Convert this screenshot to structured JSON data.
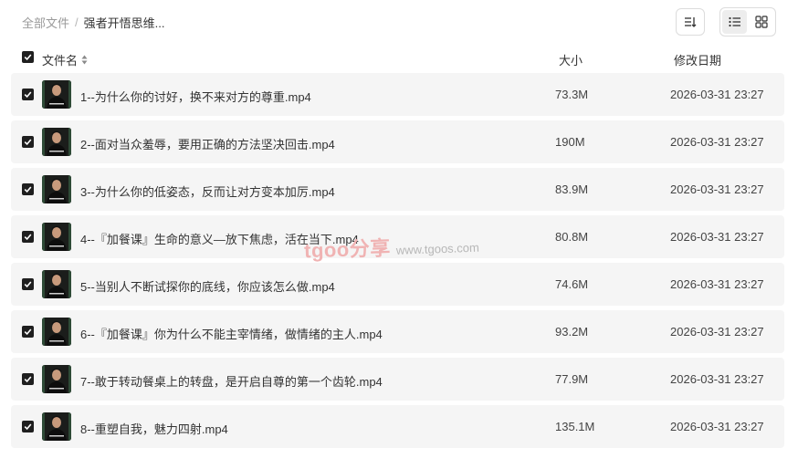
{
  "breadcrumb": {
    "root": "全部文件",
    "separator": "/",
    "current": "强者开悟思维..."
  },
  "toolbar": {
    "sort_icon": "sort-icon",
    "list_icon": "list-view-icon",
    "grid_icon": "grid-view-icon",
    "active_view": "list"
  },
  "columns": {
    "name": "文件名",
    "size": "大小",
    "date": "修改日期"
  },
  "files": [
    {
      "name": "1--为什么你的讨好，换不来对方的尊重.mp4",
      "size": "73.3M",
      "date": "2026-03-31 23:27"
    },
    {
      "name": "2--面对当众羞辱，要用正确的方法坚决回击.mp4",
      "size": "190M",
      "date": "2026-03-31 23:27"
    },
    {
      "name": "3--为什么你的低姿态，反而让对方变本加厉.mp4",
      "size": "83.9M",
      "date": "2026-03-31 23:27"
    },
    {
      "name": "4--『加餐课』生命的意义—放下焦虑，活在当下.mp4",
      "size": "80.8M",
      "date": "2026-03-31 23:27"
    },
    {
      "name": "5--当别人不断试探你的底线，你应该怎么做.mp4",
      "size": "74.6M",
      "date": "2026-03-31 23:27"
    },
    {
      "name": "6--『加餐课』你为什么不能主宰情绪，做情绪的主人.mp4",
      "size": "93.2M",
      "date": "2026-03-31 23:27"
    },
    {
      "name": "7--敢于转动餐桌上的转盘，是开启自尊的第一个齿轮.mp4",
      "size": "77.9M",
      "date": "2026-03-31 23:27"
    },
    {
      "name": "8--重塑自我，魅力四射.mp4",
      "size": "135.1M",
      "date": "2026-03-31 23:27"
    }
  ],
  "watermark": {
    "logo": "tgoo分享",
    "url": "www.tgoos.com"
  }
}
